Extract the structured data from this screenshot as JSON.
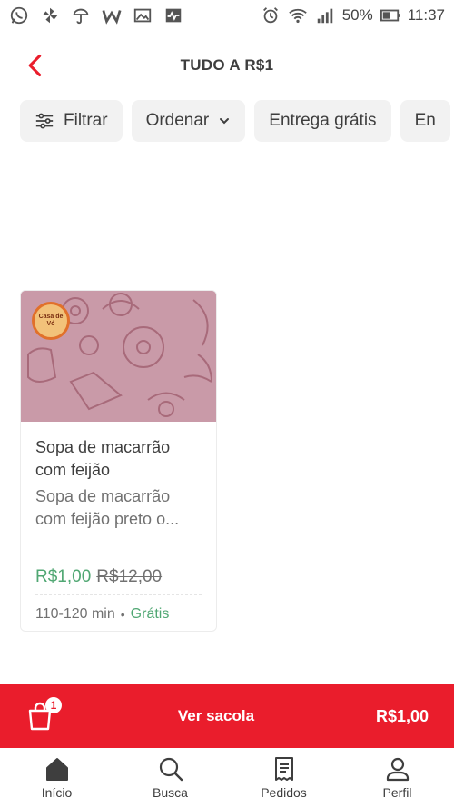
{
  "status_bar": {
    "battery": "50%",
    "time": "11:37"
  },
  "header": {
    "title": "TUDO A R$1"
  },
  "filters": [
    {
      "label": "Filtrar"
    },
    {
      "label": "Ordenar"
    },
    {
      "label": "Entrega grátis"
    },
    {
      "label": "En"
    }
  ],
  "product": {
    "name_line1": "Sopa de macarrão",
    "name_line2": "com feijão",
    "desc_line1": "Sopa de macarrão",
    "desc_line2": "com feijão preto o...",
    "price_now": "R$1,00",
    "price_old": "R$12,00",
    "time": "110-120 min",
    "delivery": "Grátis",
    "store_logo_text": "Casa de Vó"
  },
  "bag": {
    "count": "1",
    "label": "Ver sacola",
    "total": "R$1,00"
  },
  "nav": [
    {
      "label": "Início"
    },
    {
      "label": "Busca"
    },
    {
      "label": "Pedidos"
    },
    {
      "label": "Perfil"
    }
  ],
  "colors": {
    "accent": "#ea1d2c",
    "price_green": "#50a773",
    "chip_bg": "#f2f2f2"
  }
}
